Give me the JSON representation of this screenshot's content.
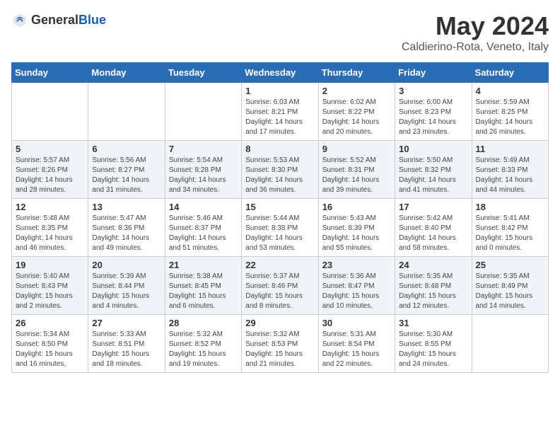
{
  "header": {
    "logo_general": "General",
    "logo_blue": "Blue",
    "month_title": "May 2024",
    "location": "Caldierino-Rota, Veneto, Italy"
  },
  "weekdays": [
    "Sunday",
    "Monday",
    "Tuesday",
    "Wednesday",
    "Thursday",
    "Friday",
    "Saturday"
  ],
  "weeks": [
    [
      {
        "day": "",
        "info": ""
      },
      {
        "day": "",
        "info": ""
      },
      {
        "day": "",
        "info": ""
      },
      {
        "day": "1",
        "info": "Sunrise: 6:03 AM\nSunset: 8:21 PM\nDaylight: 14 hours\nand 17 minutes."
      },
      {
        "day": "2",
        "info": "Sunrise: 6:02 AM\nSunset: 8:22 PM\nDaylight: 14 hours\nand 20 minutes."
      },
      {
        "day": "3",
        "info": "Sunrise: 6:00 AM\nSunset: 8:23 PM\nDaylight: 14 hours\nand 23 minutes."
      },
      {
        "day": "4",
        "info": "Sunrise: 5:59 AM\nSunset: 8:25 PM\nDaylight: 14 hours\nand 26 minutes."
      }
    ],
    [
      {
        "day": "5",
        "info": "Sunrise: 5:57 AM\nSunset: 8:26 PM\nDaylight: 14 hours\nand 28 minutes."
      },
      {
        "day": "6",
        "info": "Sunrise: 5:56 AM\nSunset: 8:27 PM\nDaylight: 14 hours\nand 31 minutes."
      },
      {
        "day": "7",
        "info": "Sunrise: 5:54 AM\nSunset: 8:28 PM\nDaylight: 14 hours\nand 34 minutes."
      },
      {
        "day": "8",
        "info": "Sunrise: 5:53 AM\nSunset: 8:30 PM\nDaylight: 14 hours\nand 36 minutes."
      },
      {
        "day": "9",
        "info": "Sunrise: 5:52 AM\nSunset: 8:31 PM\nDaylight: 14 hours\nand 39 minutes."
      },
      {
        "day": "10",
        "info": "Sunrise: 5:50 AM\nSunset: 8:32 PM\nDaylight: 14 hours\nand 41 minutes."
      },
      {
        "day": "11",
        "info": "Sunrise: 5:49 AM\nSunset: 8:33 PM\nDaylight: 14 hours\nand 44 minutes."
      }
    ],
    [
      {
        "day": "12",
        "info": "Sunrise: 5:48 AM\nSunset: 8:35 PM\nDaylight: 14 hours\nand 46 minutes."
      },
      {
        "day": "13",
        "info": "Sunrise: 5:47 AM\nSunset: 8:36 PM\nDaylight: 14 hours\nand 49 minutes."
      },
      {
        "day": "14",
        "info": "Sunrise: 5:46 AM\nSunset: 8:37 PM\nDaylight: 14 hours\nand 51 minutes."
      },
      {
        "day": "15",
        "info": "Sunrise: 5:44 AM\nSunset: 8:38 PM\nDaylight: 14 hours\nand 53 minutes."
      },
      {
        "day": "16",
        "info": "Sunrise: 5:43 AM\nSunset: 8:39 PM\nDaylight: 14 hours\nand 55 minutes."
      },
      {
        "day": "17",
        "info": "Sunrise: 5:42 AM\nSunset: 8:40 PM\nDaylight: 14 hours\nand 58 minutes."
      },
      {
        "day": "18",
        "info": "Sunrise: 5:41 AM\nSunset: 8:42 PM\nDaylight: 15 hours\nand 0 minutes."
      }
    ],
    [
      {
        "day": "19",
        "info": "Sunrise: 5:40 AM\nSunset: 8:43 PM\nDaylight: 15 hours\nand 2 minutes."
      },
      {
        "day": "20",
        "info": "Sunrise: 5:39 AM\nSunset: 8:44 PM\nDaylight: 15 hours\nand 4 minutes."
      },
      {
        "day": "21",
        "info": "Sunrise: 5:38 AM\nSunset: 8:45 PM\nDaylight: 15 hours\nand 6 minutes."
      },
      {
        "day": "22",
        "info": "Sunrise: 5:37 AM\nSunset: 8:46 PM\nDaylight: 15 hours\nand 8 minutes."
      },
      {
        "day": "23",
        "info": "Sunrise: 5:36 AM\nSunset: 8:47 PM\nDaylight: 15 hours\nand 10 minutes."
      },
      {
        "day": "24",
        "info": "Sunrise: 5:35 AM\nSunset: 8:48 PM\nDaylight: 15 hours\nand 12 minutes."
      },
      {
        "day": "25",
        "info": "Sunrise: 5:35 AM\nSunset: 8:49 PM\nDaylight: 15 hours\nand 14 minutes."
      }
    ],
    [
      {
        "day": "26",
        "info": "Sunrise: 5:34 AM\nSunset: 8:50 PM\nDaylight: 15 hours\nand 16 minutes."
      },
      {
        "day": "27",
        "info": "Sunrise: 5:33 AM\nSunset: 8:51 PM\nDaylight: 15 hours\nand 18 minutes."
      },
      {
        "day": "28",
        "info": "Sunrise: 5:32 AM\nSunset: 8:52 PM\nDaylight: 15 hours\nand 19 minutes."
      },
      {
        "day": "29",
        "info": "Sunrise: 5:32 AM\nSunset: 8:53 PM\nDaylight: 15 hours\nand 21 minutes."
      },
      {
        "day": "30",
        "info": "Sunrise: 5:31 AM\nSunset: 8:54 PM\nDaylight: 15 hours\nand 22 minutes."
      },
      {
        "day": "31",
        "info": "Sunrise: 5:30 AM\nSunset: 8:55 PM\nDaylight: 15 hours\nand 24 minutes."
      },
      {
        "day": "",
        "info": ""
      }
    ]
  ]
}
